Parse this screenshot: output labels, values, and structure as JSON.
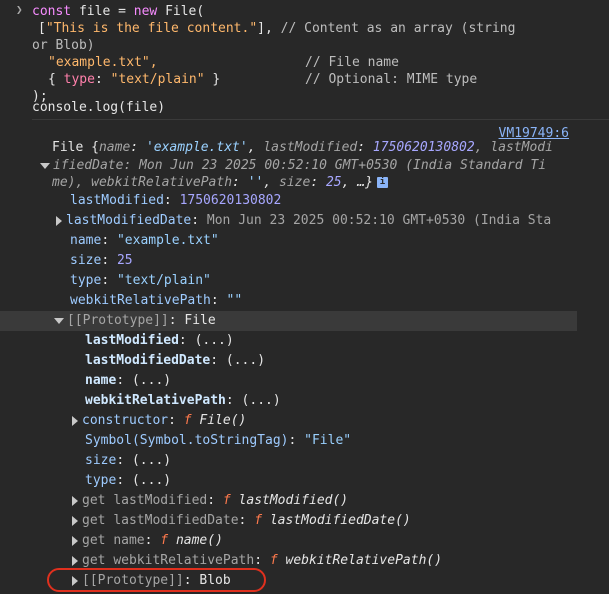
{
  "code": {
    "l1": {
      "kw_const": "const",
      "var_file": "file",
      "eq": "=",
      "kw_new": "new",
      "cls": "File("
    },
    "l2": {
      "arr_open": "[",
      "str": "\"This is the file content.\"",
      "arr_close": "], ",
      "comment": "// Content as an array (string"
    },
    "l3": {
      "comment": "or Blob)"
    },
    "l4": {
      "str": "\"example.txt\",",
      "comment": "// File name"
    },
    "l5": {
      "open": "{ ",
      "key": "type",
      "colon": ": ",
      "str": "\"text/plain\"",
      "close": " }",
      "comment": "// Optional: MIME type"
    },
    "l6": {
      "text": ");"
    },
    "l7": {
      "text": "console.",
      "fn": "log",
      "args": "(file)"
    }
  },
  "source_link": "VM19749:6",
  "summary": {
    "line1_pre": "File {",
    "name_key": "name",
    "name_val": "'example.txt'",
    "lm_key": "lastModified",
    "lm_val": "1750620130802",
    "lm_tail": ", lastModi",
    "line2": "ifiedDate: Mon Jun 23 2025 00:52:10 GMT+0530 (India Standard Ti",
    "line3_pre": "me), ",
    "wrp_key": "webkitRelativePath",
    "wrp_val": "''",
    "size_key": "size",
    "size_val": "25",
    "tail": ", …}",
    "info": "i"
  },
  "props": {
    "lastModified": {
      "key": "lastModified",
      "val": "1750620130802"
    },
    "lastModifiedDate": {
      "key": "lastModifiedDate",
      "val": "Mon Jun 23 2025 00:52:10 GMT+0530 (India Sta"
    },
    "name": {
      "key": "name",
      "val": "\"example.txt\""
    },
    "size": {
      "key": "size",
      "val": "25"
    },
    "type": {
      "key": "type",
      "val": "\"text/plain\""
    },
    "webkitRelativePath": {
      "key": "webkitRelativePath",
      "val": "\"\""
    }
  },
  "prototype": {
    "label": "[[Prototype]]",
    "val": "File",
    "items": {
      "lastModified": "lastModified",
      "lastModifiedDate": "lastModifiedDate",
      "name": "name",
      "webkitRelativePath": "webkitRelativePath",
      "ellipsis": "(...)",
      "constructor_key": "constructor",
      "constructor_f": "f",
      "constructor_val": "File()",
      "symbol_key": "Symbol(Symbol.toStringTag)",
      "symbol_val": "\"File\"",
      "size": "size",
      "type": "type",
      "get": "get",
      "get_lm_key": "lastModified",
      "get_lm_fn": "lastModified()",
      "get_lmd_key": "lastModifiedDate",
      "get_lmd_fn": "lastModifiedDate()",
      "get_name_key": "name",
      "get_name_fn": "name()",
      "get_wrp_key": "webkitRelativePath",
      "get_wrp_fn": "webkitRelativePath()",
      "proto2_label": "[[Prototype]]",
      "proto2_val": "Blob"
    }
  },
  "colors": {
    "background": "#282828",
    "highlight": "#e0301e",
    "link": "#8ab4f8"
  }
}
